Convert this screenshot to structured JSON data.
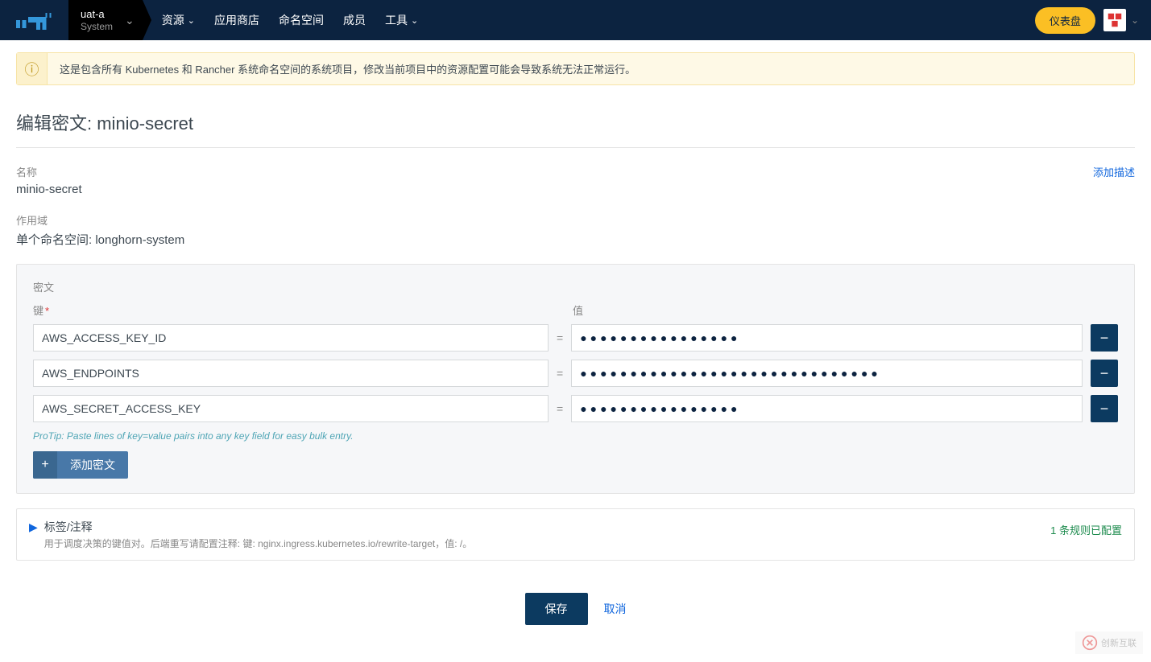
{
  "header": {
    "project": {
      "name": "uat-a",
      "type": "System"
    },
    "nav": {
      "resources": "资源",
      "app_store": "应用商店",
      "namespaces": "命名空间",
      "members": "成员",
      "tools": "工具"
    },
    "dashboard_btn": "仪表盘"
  },
  "banner": {
    "text": "这是包含所有 Kubernetes 和 Rancher 系统命名空间的系统项目，修改当前项目中的资源配置可能会导致系统无法正常运行。"
  },
  "page_title": "编辑密文: minio-secret",
  "fields": {
    "name_label": "名称",
    "name_value": "minio-secret",
    "add_desc": "添加描述",
    "scope_label": "作用域",
    "scope_value": "单个命名空间: longhorn-system"
  },
  "secrets": {
    "title": "密文",
    "key_header": "键",
    "value_header": "值",
    "rows": [
      {
        "key": "AWS_ACCESS_KEY_ID",
        "value_masked": "●●●●●●●●●●●●●●●●"
      },
      {
        "key": "AWS_ENDPOINTS",
        "value_masked": "●●●●●●●●●●●●●●●●●●●●●●●●●●●●●●"
      },
      {
        "key": "AWS_SECRET_ACCESS_KEY",
        "value_masked": "●●●●●●●●●●●●●●●●"
      }
    ],
    "protip": "ProTip: Paste lines of key=value pairs into any key field for easy bulk entry.",
    "add_btn": "添加密文"
  },
  "labels_section": {
    "title": "标签/注释",
    "description": "用于调度决策的键值对。后端重写请配置注释: 键: nginx.ingress.kubernetes.io/rewrite-target，值: /。",
    "badge": "1 条规则已配置"
  },
  "actions": {
    "save": "保存",
    "cancel": "取消"
  },
  "watermark": "创新互联"
}
